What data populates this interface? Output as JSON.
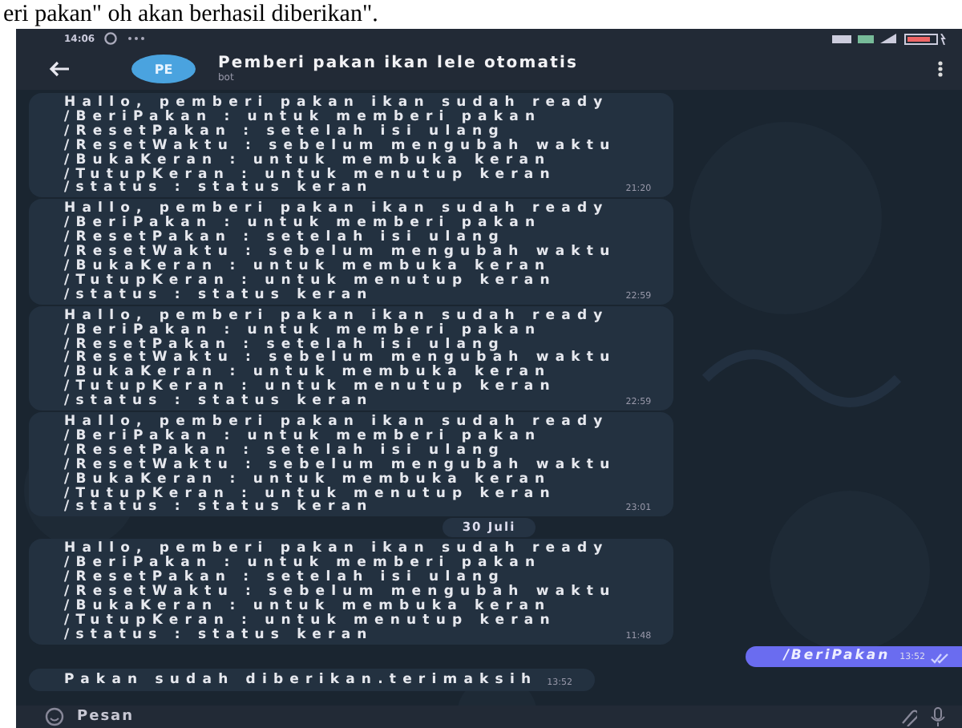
{
  "document_text": "eri pakan\" oh akan berhasil diberikan\".",
  "status_bar": {
    "time": "14:06"
  },
  "header": {
    "avatar": "PE",
    "title": "Pemberi pakan ikan lele otomatis",
    "subtitle": "bot"
  },
  "messages": [
    {
      "kind": "incoming",
      "lines": [
        "Hallo, pemberi pakan ikan sudah ready",
        "/BeriPakan : untuk memberi pakan",
        "/ResetPakan : setelah isi ulang",
        "/ResetWaktu : sebelum mengubah waktu",
        "/BukaKeran : untuk membuka keran",
        "/TutupKeran : untuk menutup keran",
        "/status : status keran"
      ],
      "time": "21:20"
    },
    {
      "kind": "incoming",
      "lines": [
        "Hallo, pemberi pakan ikan sudah ready",
        "/BeriPakan : untuk memberi pakan",
        "/ResetPakan : setelah isi ulang",
        "/ResetWaktu : sebelum mengubah waktu",
        "/BukaKeran : untuk membuka keran",
        "/TutupKeran : untuk menutup keran",
        "/status : status keran"
      ],
      "time": "22:59"
    },
    {
      "kind": "incoming",
      "lines": [
        "Hallo, pemberi pakan ikan sudah ready",
        "/BeriPakan : untuk memberi pakan",
        "/ResetPakan : setelah isi ulang",
        "/ResetWaktu : sebelum mengubah waktu",
        "/BukaKeran : untuk membuka keran",
        "/TutupKeran : untuk menutup keran",
        "/status : status keran"
      ],
      "time": "22:59"
    },
    {
      "kind": "incoming",
      "lines": [
        "Hallo, pemberi pakan ikan sudah ready",
        "/BeriPakan : untuk memberi pakan",
        "/ResetPakan : setelah isi ulang",
        "/ResetWaktu : sebelum mengubah waktu",
        "/BukaKeran : untuk membuka keran",
        "/TutupKeran : untuk menutup keran",
        "/status : status keran"
      ],
      "time": "23:01"
    },
    {
      "kind": "date",
      "text": "30 Juli"
    },
    {
      "kind": "incoming",
      "lines": [
        "Hallo, pemberi pakan ikan sudah ready",
        "/BeriPakan : untuk memberi pakan",
        "/ResetPakan : setelah isi ulang",
        "/ResetWaktu : sebelum mengubah waktu",
        "/BukaKeran : untuk membuka keran",
        "/TutupKeran : untuk menutup keran",
        "/status : status keran"
      ],
      "time": "11:48"
    },
    {
      "kind": "outgoing",
      "lines": [
        "/BeriPakan"
      ],
      "time": "13:52",
      "read": true
    },
    {
      "kind": "incoming",
      "lines": [
        "Pakan sudah diberikan.terimaksih"
      ],
      "time": "13:52"
    }
  ],
  "composer": {
    "placeholder": "Pesan"
  }
}
